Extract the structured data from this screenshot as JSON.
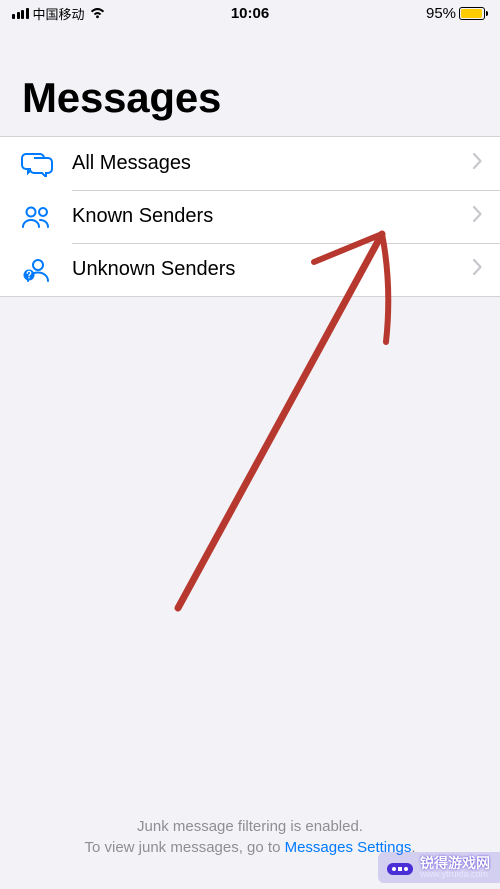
{
  "status_bar": {
    "carrier": "中国移动",
    "time": "10:06",
    "battery_percent": "95%",
    "battery_fill_pct": 95
  },
  "header": {
    "title": "Messages"
  },
  "filters": [
    {
      "icon": "all-messages-icon",
      "label": "All Messages"
    },
    {
      "icon": "known-senders-icon",
      "label": "Known Senders"
    },
    {
      "icon": "unknown-senders-icon",
      "label": "Unknown Senders"
    }
  ],
  "footer": {
    "line1": "Junk message filtering is enabled.",
    "line2_prefix": "To view junk messages, go to ",
    "link_text": "Messages Settings"
  },
  "watermark": {
    "title": "锐得游戏网",
    "url": "www.ytruida.com"
  }
}
